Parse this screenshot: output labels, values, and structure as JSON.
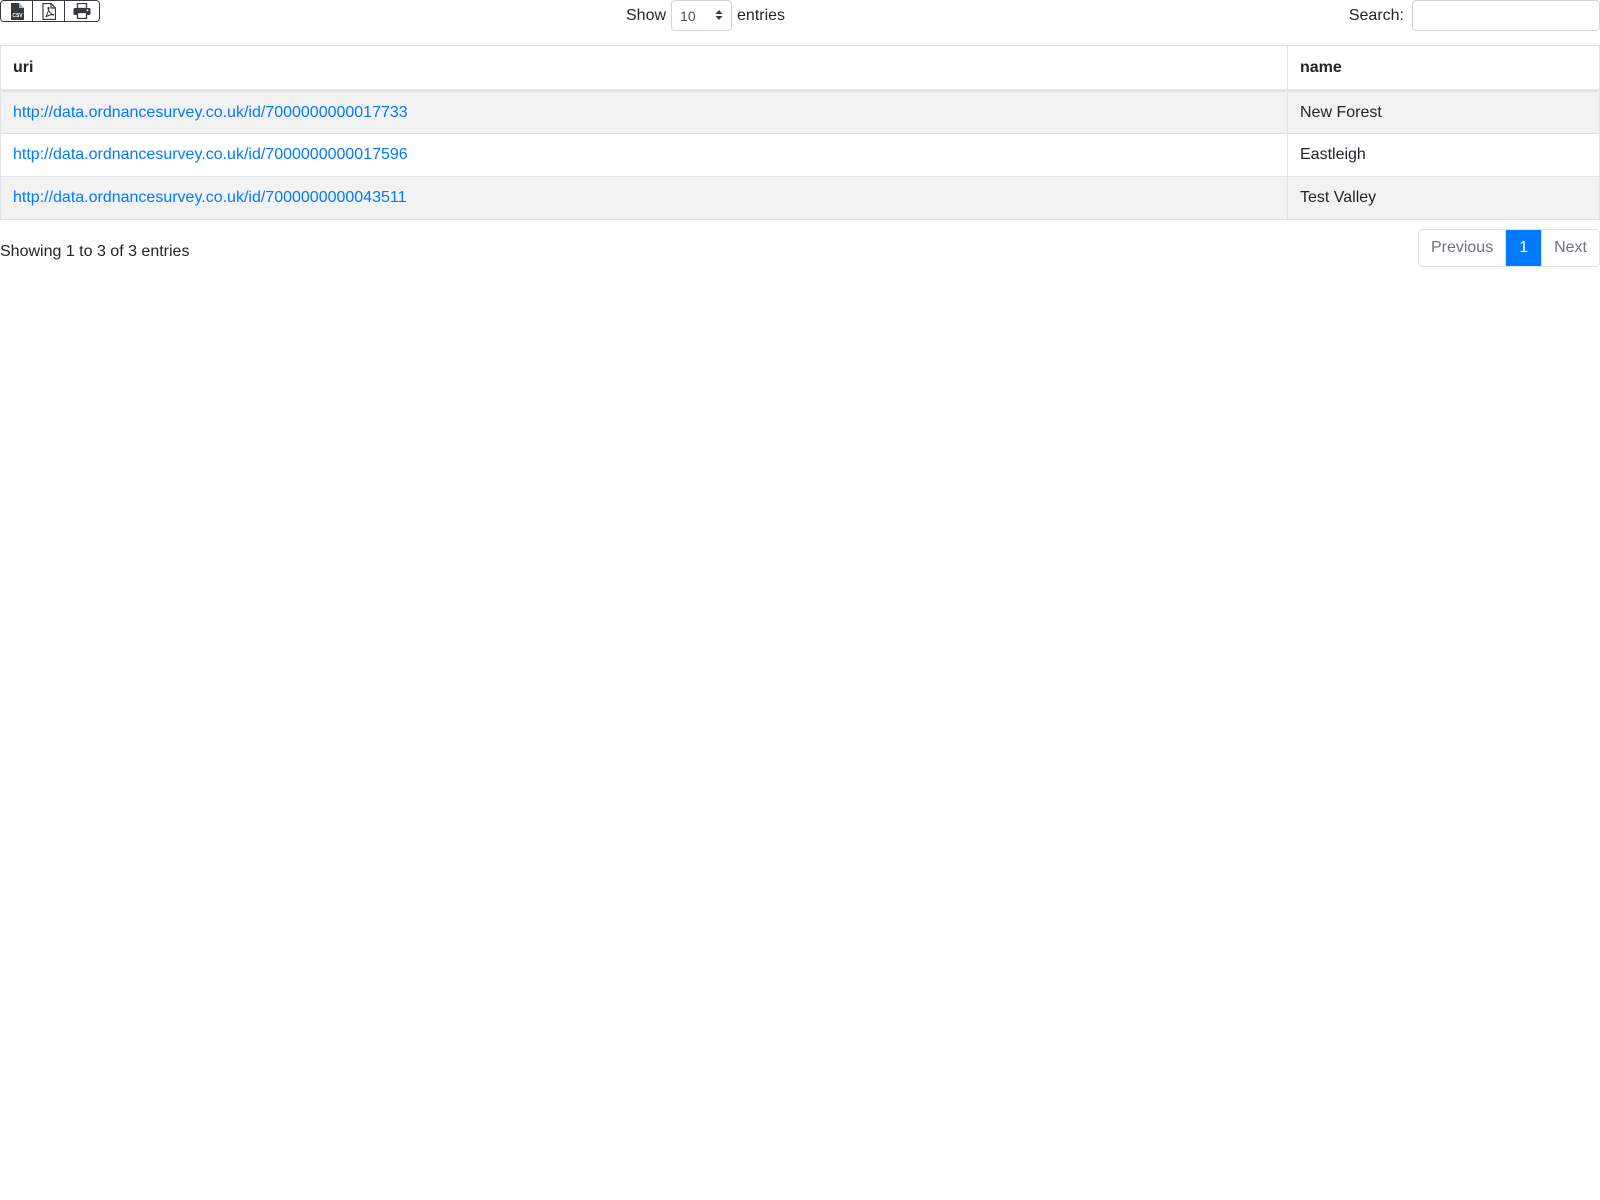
{
  "toolbar": {
    "buttons": [
      {
        "icon": "csv-file-icon"
      },
      {
        "icon": "pdf-file-icon"
      },
      {
        "icon": "printer-icon"
      }
    ]
  },
  "length_control": {
    "show_label": "Show",
    "selected_value": "10",
    "entries_label": "entries"
  },
  "search": {
    "label": "Search:",
    "value": "",
    "placeholder": ""
  },
  "table": {
    "columns": [
      "uri",
      "name"
    ],
    "rows": [
      {
        "uri": "http://data.ordnancesurvey.co.uk/id/7000000000017733",
        "name": "New Forest"
      },
      {
        "uri": "http://data.ordnancesurvey.co.uk/id/7000000000017596",
        "name": "Eastleigh"
      },
      {
        "uri": "http://data.ordnancesurvey.co.uk/id/7000000000043511",
        "name": "Test Valley"
      }
    ]
  },
  "footer": {
    "info": "Showing 1 to 3 of 3 entries",
    "pagination": {
      "previous": "Previous",
      "pages": [
        "1"
      ],
      "active_page": "1",
      "next": "Next"
    }
  },
  "colors": {
    "link": "#007bff",
    "active_page_bg": "#007bff",
    "striped_row_bg": "#f2f2f2"
  }
}
